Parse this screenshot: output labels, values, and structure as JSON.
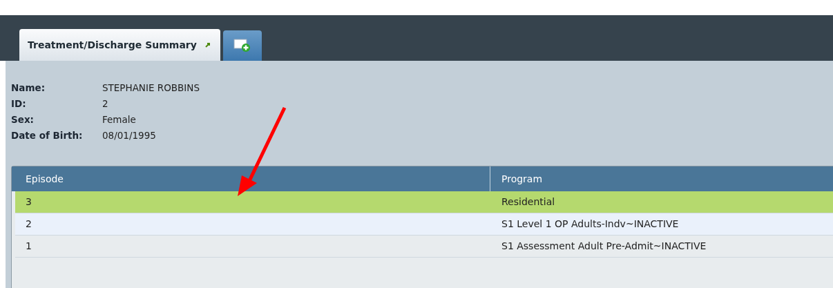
{
  "tabs": [
    {
      "label": "Treatment/Discharge Summary",
      "selected": true,
      "kind": "document"
    },
    {
      "kind": "add",
      "selected": false
    }
  ],
  "patient": [
    {
      "label": "Name:",
      "value": "STEPHANIE ROBBINS"
    },
    {
      "label": "ID:",
      "value": "2"
    },
    {
      "label": "Sex:",
      "value": "Female"
    },
    {
      "label": "Date of Birth:",
      "value": "08/01/1995"
    }
  ],
  "table": {
    "columns": [
      "Episode",
      "Program"
    ],
    "rows": [
      {
        "cells": [
          "3",
          "Residential"
        ],
        "selected": true
      },
      {
        "cells": [
          "2",
          "S1 Level 1 OP Adults-Indv~INACTIVE"
        ],
        "selected": false
      },
      {
        "cells": [
          "1",
          "S1 Assessment Adult Pre-Admit~INACTIVE"
        ],
        "selected": false
      }
    ]
  }
}
